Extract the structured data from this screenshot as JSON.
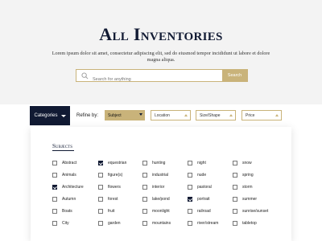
{
  "header": {
    "title": "All Inventories",
    "subtitle": "Lorem ipsum dolor sit amet, consectetur adipiscing elit, sed do eiusmod tempor incididunt ut labore et dolore magna aliqua."
  },
  "search": {
    "placeholder": "Search for anything",
    "button_label": "Search"
  },
  "filters": {
    "categories_label": "Categories",
    "refine_label": "Refine by:",
    "selects": [
      {
        "label": "Subject"
      },
      {
        "label": "Location"
      },
      {
        "label": "Size/Shape"
      },
      {
        "label": "Price"
      }
    ]
  },
  "subjects": {
    "title": "Subjects",
    "columns": [
      [
        {
          "label": "Abstract",
          "checked": false
        },
        {
          "label": "Animals",
          "checked": false
        },
        {
          "label": "Architecture",
          "checked": true
        },
        {
          "label": "Autumn",
          "checked": false
        },
        {
          "label": "Boats",
          "checked": false
        },
        {
          "label": "City",
          "checked": false
        }
      ],
      [
        {
          "label": "equestrian",
          "checked": true
        },
        {
          "label": "figure(s)",
          "checked": false
        },
        {
          "label": "flowers",
          "checked": false
        },
        {
          "label": "forest",
          "checked": false
        },
        {
          "label": "fruit",
          "checked": false
        },
        {
          "label": "garden",
          "checked": false
        }
      ],
      [
        {
          "label": "hunting",
          "checked": false
        },
        {
          "label": "industrial",
          "checked": false
        },
        {
          "label": "interior",
          "checked": false
        },
        {
          "label": "lake/pond",
          "checked": false
        },
        {
          "label": "moonlight",
          "checked": false
        },
        {
          "label": "mountains",
          "checked": false
        }
      ],
      [
        {
          "label": "night",
          "checked": false
        },
        {
          "label": "nude",
          "checked": false
        },
        {
          "label": "pastoral",
          "checked": false
        },
        {
          "label": "portrait",
          "checked": true
        },
        {
          "label": "railroad",
          "checked": false
        },
        {
          "label": "river/stream",
          "checked": false
        }
      ],
      [
        {
          "label": "snow",
          "checked": false
        },
        {
          "label": "spring",
          "checked": false
        },
        {
          "label": "storm",
          "checked": false
        },
        {
          "label": "summer",
          "checked": false
        },
        {
          "label": "sunrise/sunset",
          "checked": false
        },
        {
          "label": "tabletop",
          "checked": false
        }
      ]
    ]
  },
  "colors": {
    "navy": "#111a33",
    "gold": "#c9b37a",
    "hero_bg": "#f3f3f3"
  }
}
